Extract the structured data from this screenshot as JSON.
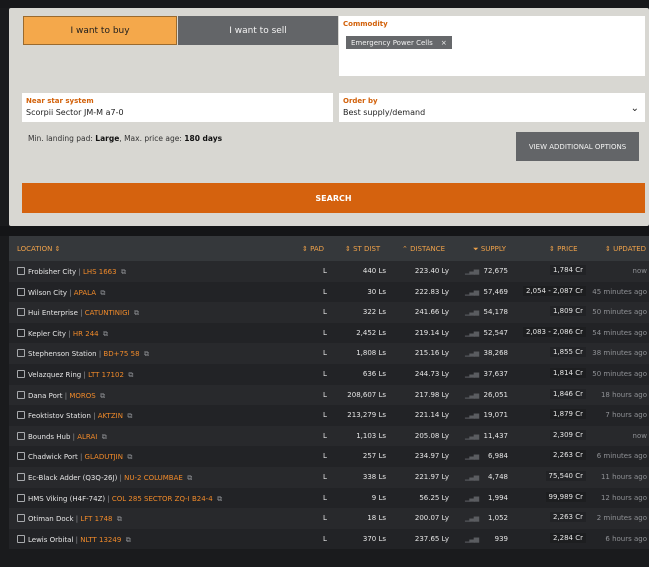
{
  "filters": {
    "buy_label": "I want to buy",
    "sell_label": "I want to sell",
    "commodity_label": "Commodity",
    "commodity_chip": "Emergency Power Cells",
    "chip_remove": "×",
    "near_label": "Near star system",
    "near_value": "Scorpii Sector JM-M a7-0",
    "order_label": "Order by",
    "order_value": "Best supply/demand",
    "order_chevron": "⌄",
    "min_pad_prefix": "Min. landing pad:",
    "min_pad_value": "Large",
    "max_age_prefix": ", Max. price age:",
    "max_age_value": "180 days",
    "advanced_label": "VIEW ADDITIONAL OPTIONS",
    "search_label": "SEARCH"
  },
  "table": {
    "headers": {
      "location": "LOCATION ⇕",
      "pad": "⇕ PAD",
      "st_dist": "⇕ ST DIST",
      "distance": "⌃ DISTANCE",
      "supply": "⏷ SUPPLY",
      "price": "⇕ PRICE",
      "updated": "⇕ UPDATED"
    },
    "rows": [
      {
        "station": "Frobisher City",
        "system": "LHS 1663",
        "pad": "L",
        "st_dist": "440 Ls",
        "distance": "223.40 Ly",
        "supply": "72,675",
        "price": "1,784 Cr",
        "updated": "now"
      },
      {
        "station": "Wilson City",
        "system": "APALA",
        "pad": "L",
        "st_dist": "30 Ls",
        "distance": "222.83 Ly",
        "supply": "57,469",
        "price": "2,054 - 2,087 Cr",
        "updated": "45 minutes ago"
      },
      {
        "station": "Hui Enterprise",
        "system": "CATUNTINIGI",
        "pad": "L",
        "st_dist": "322 Ls",
        "distance": "241.66 Ly",
        "supply": "54,178",
        "price": "1,809 Cr",
        "updated": "50 minutes ago"
      },
      {
        "station": "Kepler City",
        "system": "HR 244",
        "pad": "L",
        "st_dist": "2,452 Ls",
        "distance": "219.14 Ly",
        "supply": "52,547",
        "price": "2,083 - 2,086 Cr",
        "updated": "54 minutes ago"
      },
      {
        "station": "Stephenson Station",
        "system": "BD+75 58",
        "pad": "L",
        "st_dist": "1,808 Ls",
        "distance": "215.16 Ly",
        "supply": "38,268",
        "price": "1,855 Cr",
        "updated": "38 minutes ago"
      },
      {
        "station": "Velazquez Ring",
        "system": "LTT 17102",
        "pad": "L",
        "st_dist": "636 Ls",
        "distance": "244.73 Ly",
        "supply": "37,637",
        "price": "1,814 Cr",
        "updated": "50 minutes ago"
      },
      {
        "station": "Dana Port",
        "system": "MOROS",
        "pad": "L",
        "st_dist": "208,607 Ls",
        "distance": "217.98 Ly",
        "supply": "26,051",
        "price": "1,846 Cr",
        "updated": "18 hours ago"
      },
      {
        "station": "Feoktistov Station",
        "system": "AKTZIN",
        "pad": "L",
        "st_dist": "213,279 Ls",
        "distance": "221.14 Ly",
        "supply": "19,071",
        "price": "1,879 Cr",
        "updated": "7 hours ago"
      },
      {
        "station": "Bounds Hub",
        "system": "ALRAI",
        "pad": "L",
        "st_dist": "1,103 Ls",
        "distance": "205.08 Ly",
        "supply": "11,437",
        "price": "2,309 Cr",
        "updated": "now"
      },
      {
        "station": "Chadwick Port",
        "system": "GLADUTJIN",
        "pad": "L",
        "st_dist": "257 Ls",
        "distance": "234.97 Ly",
        "supply": "6,984",
        "price": "2,263 Cr",
        "updated": "6 minutes ago"
      },
      {
        "station": "Ec-Black Adder (Q3Q-26J)",
        "system": "NU-2 COLUMBAE",
        "pad": "L",
        "st_dist": "338 Ls",
        "distance": "221.97 Ly",
        "supply": "4,748",
        "price": "75,540 Cr",
        "updated": "11 hours ago"
      },
      {
        "station": "HMS Viking (H4F-74Z)",
        "system": "COL 285 SECTOR ZQ-I B24-4",
        "pad": "L",
        "st_dist": "9 Ls",
        "distance": "56.25 Ly",
        "supply": "1,994",
        "price": "99,989 Cr",
        "updated": "12 hours ago"
      },
      {
        "station": "Otiman Dock",
        "system": "LFT 1748",
        "pad": "L",
        "st_dist": "18 Ls",
        "distance": "200.07 Ly",
        "supply": "1,052",
        "price": "2,263 Cr",
        "updated": "2 minutes ago"
      },
      {
        "station": "Lewis Orbital",
        "system": "NLTT 13249",
        "pad": "L",
        "st_dist": "370 Ls",
        "distance": "237.65 Ly",
        "supply": "939",
        "price": "2,284 Cr",
        "updated": "6 hours ago"
      }
    ]
  },
  "colors": {
    "accent": "#f4a84b",
    "search": "#d5620e",
    "system_link": "#f08a2a"
  },
  "icons": {
    "station": "station-icon",
    "copy": "copy-icon",
    "fleet": "fleet-carrier-icon",
    "bars": "signal-bars-icon"
  }
}
